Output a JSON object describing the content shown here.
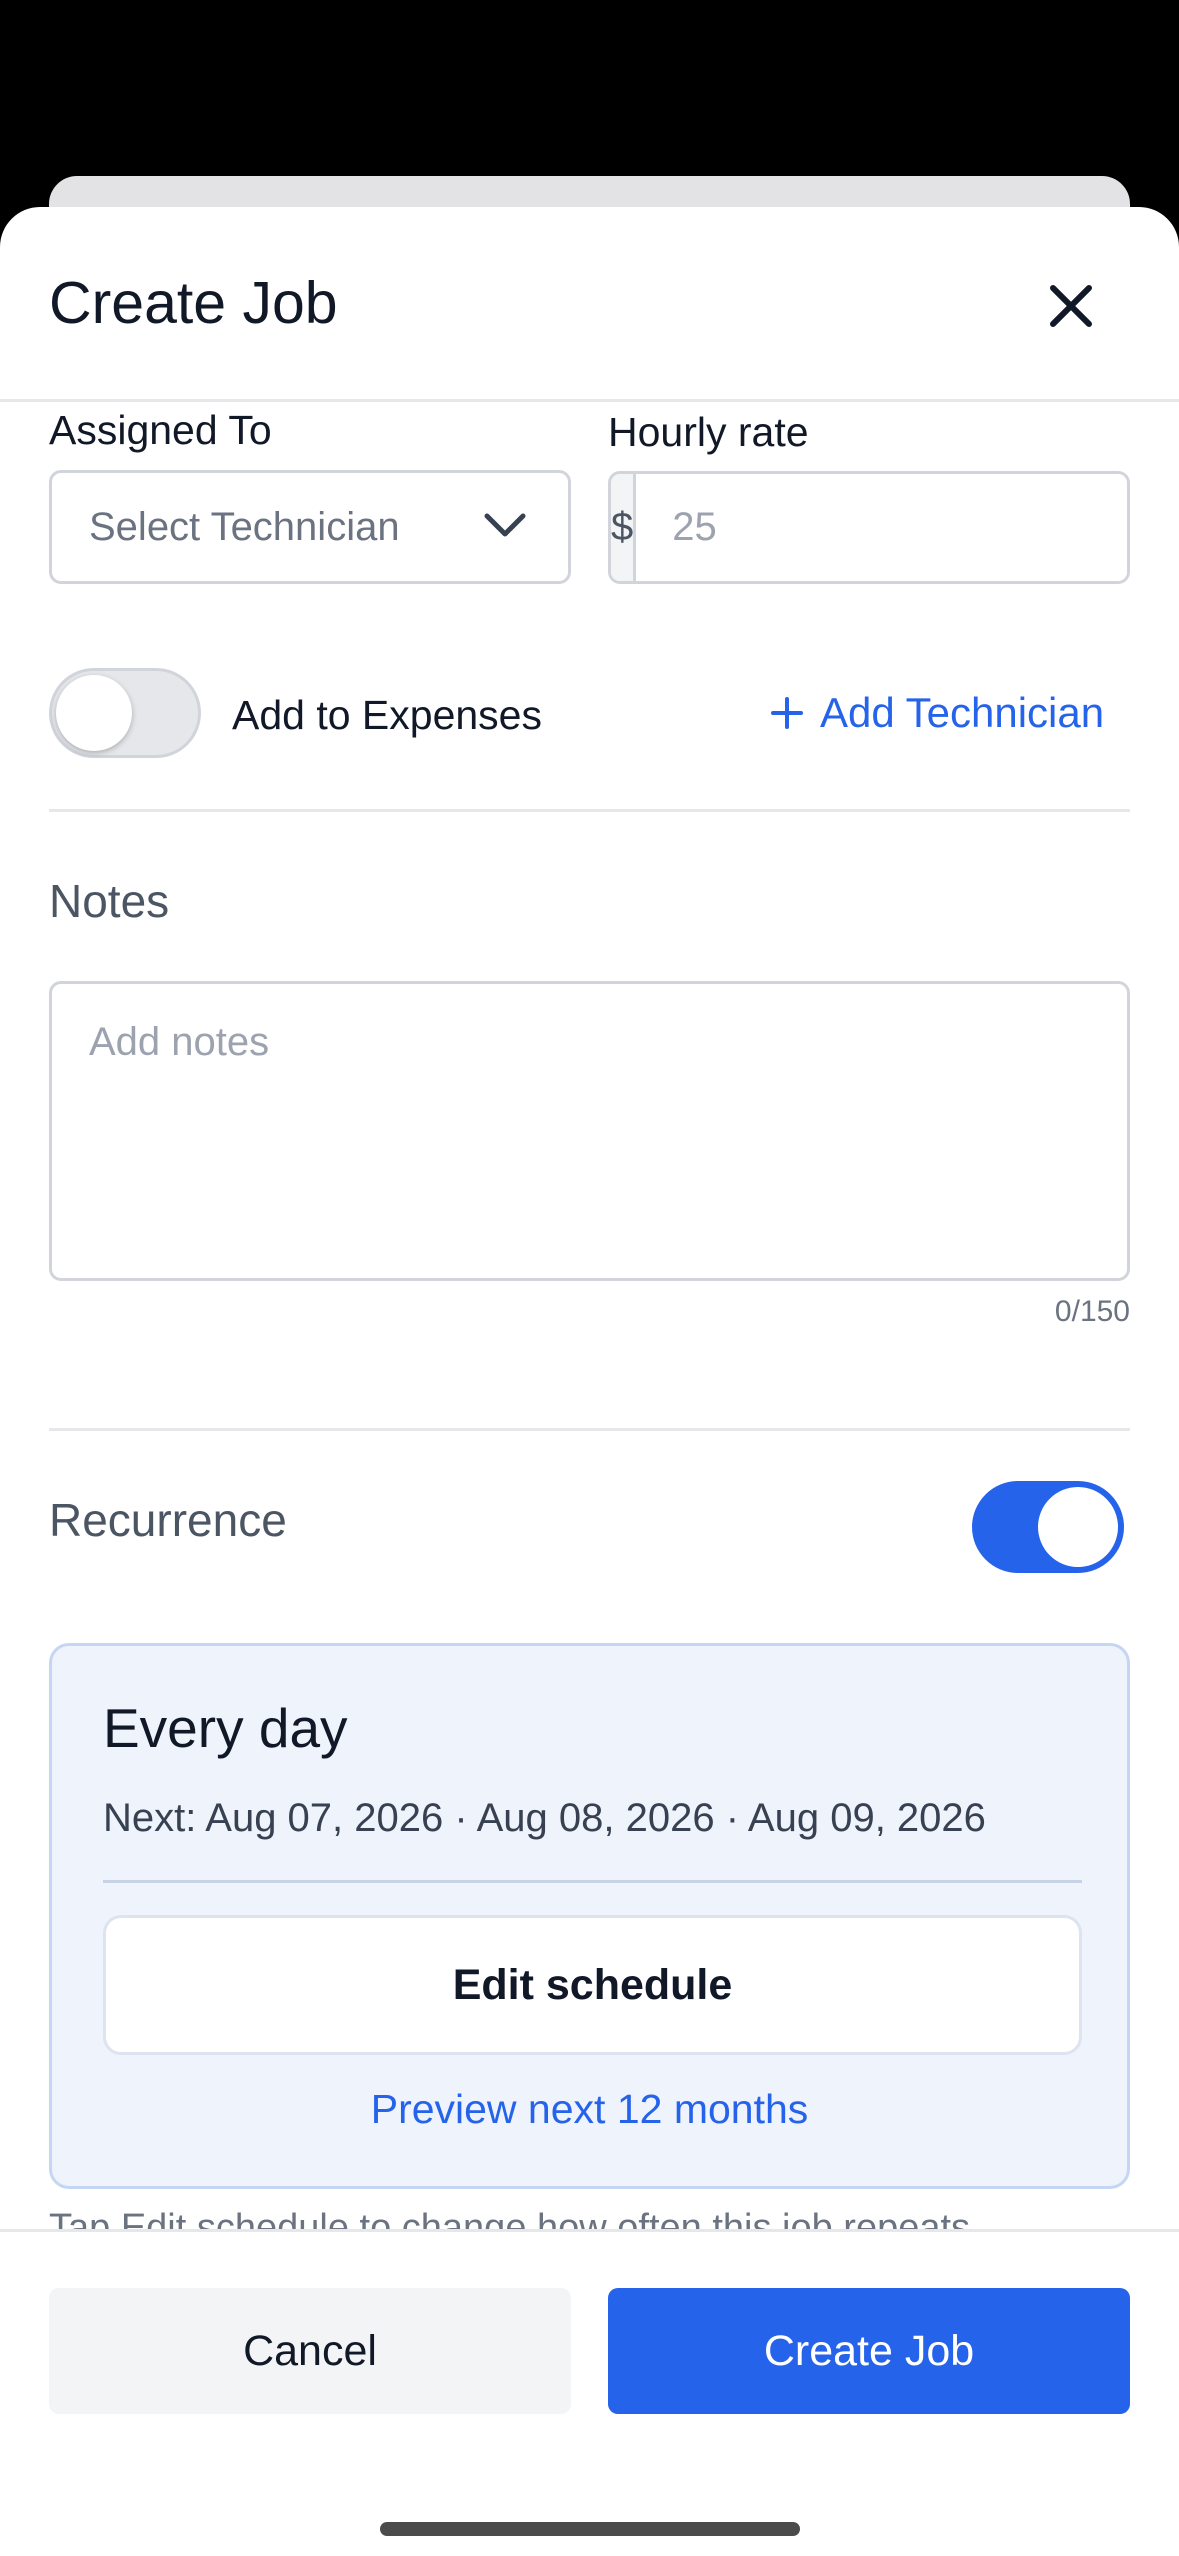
{
  "header": {
    "title": "Create Job",
    "close_icon": "close-icon"
  },
  "assignment": {
    "assigned_label": "Assigned To",
    "technician_placeholder": "Select Technician",
    "rate_label": "Hourly rate",
    "rate_prefix": "$",
    "rate_placeholder": "25",
    "expenses_label": "Add to Expenses",
    "expenses_enabled": false,
    "add_technician_label": "Add Technician"
  },
  "notes": {
    "label": "Notes",
    "placeholder": "Add notes",
    "counter": "0/150"
  },
  "recurrence": {
    "label": "Recurrence",
    "enabled": true,
    "frequency": "Every day",
    "next_dates": "Next: Aug 07, 2026 · Aug 08, 2026 · Aug 09, 2026",
    "edit_label": "Edit schedule",
    "preview_label": "Preview next 12 months",
    "hint": "Tap Edit schedule to change how often this job repeats."
  },
  "footer": {
    "cancel_label": "Cancel",
    "create_label": "Create Job"
  },
  "colors": {
    "accent": "#2563eb",
    "text": "#111827",
    "muted": "#6b7280",
    "border": "#d1d5db",
    "card_bg": "#eef3fc"
  }
}
